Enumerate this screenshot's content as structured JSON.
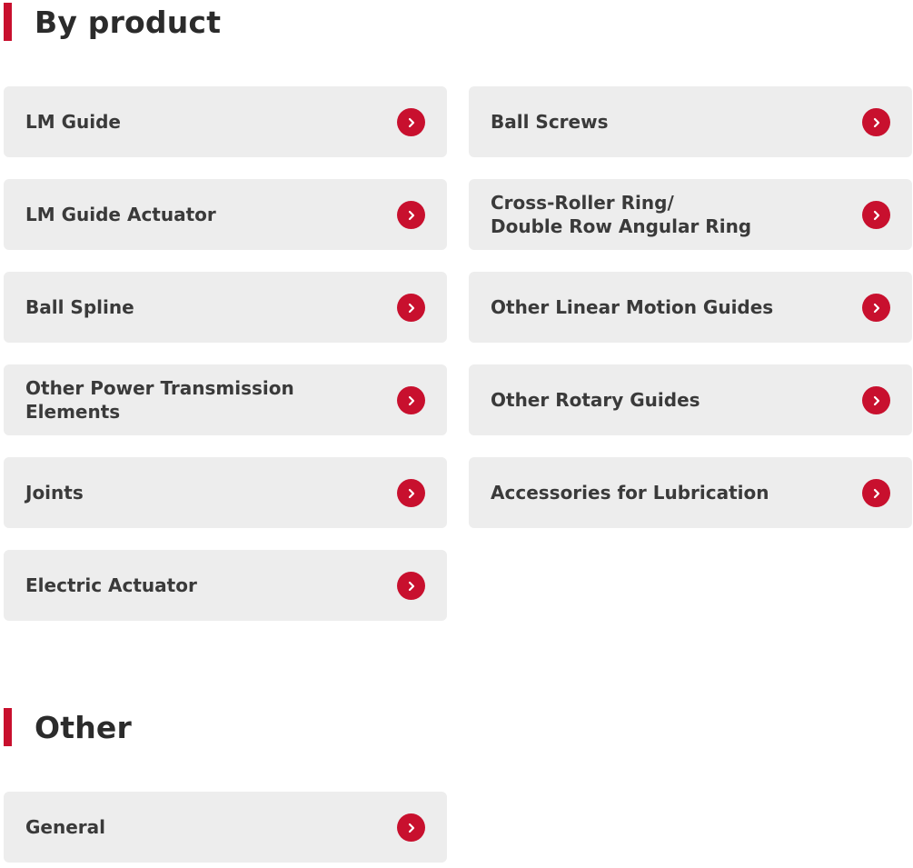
{
  "sections": [
    {
      "title": "By product",
      "items": [
        {
          "label": "LM Guide"
        },
        {
          "label": "Ball Screws"
        },
        {
          "label": "LM Guide Actuator"
        },
        {
          "label": "Cross-Roller Ring/\nDouble Row Angular Ring"
        },
        {
          "label": "Ball Spline"
        },
        {
          "label": "Other Linear Motion Guides"
        },
        {
          "label": "Other Power Transmission Elements"
        },
        {
          "label": "Other Rotary Guides"
        },
        {
          "label": "Joints"
        },
        {
          "label": "Accessories for Lubrication"
        },
        {
          "label": "Electric Actuator"
        }
      ]
    },
    {
      "title": "Other",
      "items": [
        {
          "label": "General"
        }
      ]
    }
  ],
  "colors": {
    "accent": "#c8102e",
    "card_background": "#ededed",
    "text": "#333333"
  },
  "icons": {
    "card_arrow": "chevron-right-circle-icon"
  }
}
